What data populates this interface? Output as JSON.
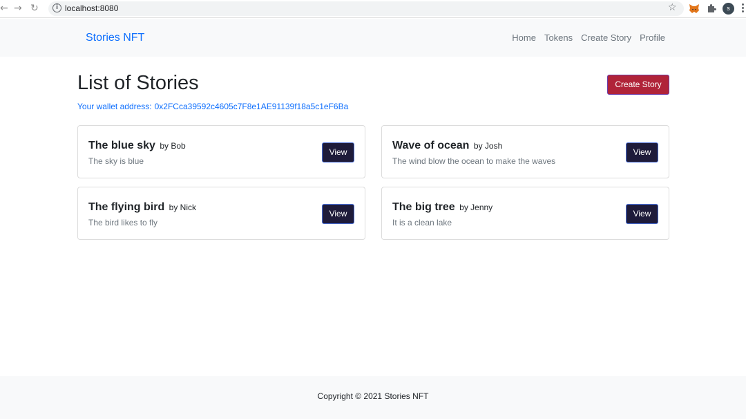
{
  "browser": {
    "url": "localhost:8080",
    "back_glyph": "←",
    "forward_glyph": "→",
    "reload_glyph": "↻",
    "info_glyph": "i",
    "star_glyph": "☆",
    "profile_initial": "s",
    "icons": [
      "back-arrow-icon",
      "forward-arrow-icon",
      "reload-icon",
      "info-icon",
      "star-icon",
      "metamask-fox-icon",
      "puzzle-icon",
      "profile-avatar",
      "kebab-menu-icon"
    ]
  },
  "navbar": {
    "brand": "Stories NFT",
    "links": [
      "Home",
      "Tokens",
      "Create Story",
      "Profile"
    ]
  },
  "main": {
    "title": "List of Stories",
    "create_button": "Create Story",
    "wallet_label": "Your wallet address:",
    "wallet_address": "0x2FCca39592c4605c7F8e1AE91139f18a5c1eF6Ba"
  },
  "stories": [
    {
      "title": "The blue sky",
      "by": "by Bob",
      "description": "The sky is blue",
      "button": "View"
    },
    {
      "title": "Wave of ocean",
      "by": "by Josh",
      "description": "The wind blow the ocean to make the waves",
      "button": "View"
    },
    {
      "title": "The flying bird",
      "by": "by Nick",
      "description": "The bird likes to fly",
      "button": "View"
    },
    {
      "title": "The big tree",
      "by": "by Jenny",
      "description": "It is a clean lake",
      "button": "View"
    }
  ],
  "footer": {
    "text": "Copyright © 2021 Stories NFT"
  },
  "colors": {
    "brand_blue": "#0d6efd",
    "create_button": "#b02339",
    "view_button": "#1e1b3a",
    "muted_text": "#6c757d"
  }
}
